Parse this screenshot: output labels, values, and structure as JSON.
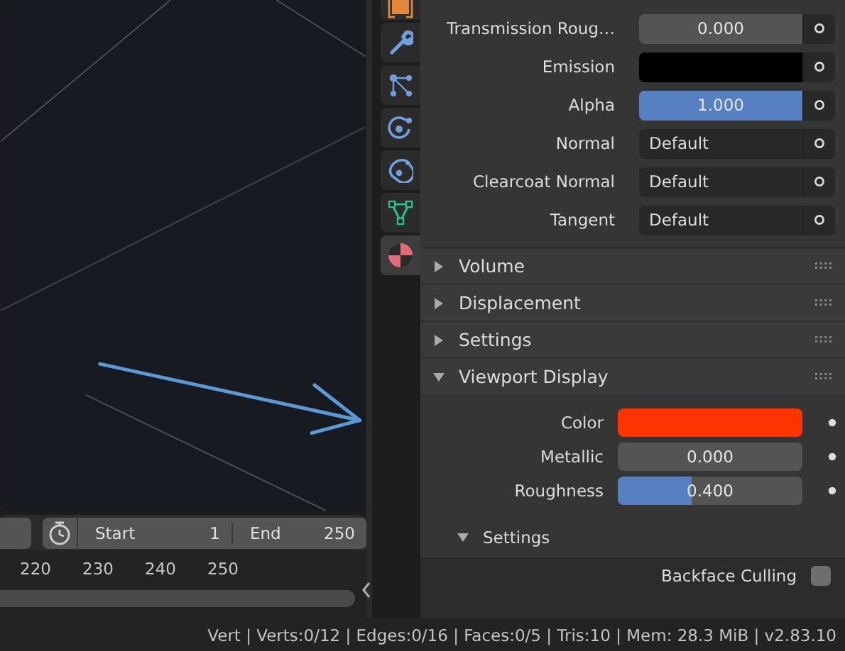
{
  "timeline": {
    "start_label": "Start",
    "start": "1",
    "end_label": "End",
    "end": "250",
    "ticks": [
      "220",
      "230",
      "240",
      "250"
    ]
  },
  "tabs": [
    {
      "kind": "object",
      "selected": false
    },
    {
      "kind": "modifier",
      "selected": false
    },
    {
      "kind": "particles",
      "selected": false
    },
    {
      "kind": "physics",
      "selected": false
    },
    {
      "kind": "constraints",
      "selected": false
    },
    {
      "kind": "data",
      "selected": false
    },
    {
      "kind": "material",
      "selected": true
    }
  ],
  "material_inputs": [
    {
      "label": "Transmission Roug…",
      "kind": "slider",
      "level": 0,
      "value": "0.000"
    },
    {
      "label": "Emission",
      "kind": "color",
      "color": "#000000"
    },
    {
      "label": "Alpha",
      "kind": "slider",
      "level": 1,
      "value": "1.000"
    },
    {
      "label": "Normal",
      "kind": "dropdown",
      "value": "Default"
    },
    {
      "label": "Clearcoat Normal",
      "kind": "dropdown",
      "value": "Default"
    },
    {
      "label": "Tangent",
      "kind": "dropdown",
      "value": "Default"
    }
  ],
  "panels": [
    {
      "title": "Volume",
      "expanded": false
    },
    {
      "title": "Displacement",
      "expanded": false
    },
    {
      "title": "Settings",
      "expanded": false
    },
    {
      "title": "Viewport Display",
      "expanded": true
    }
  ],
  "viewport_display": {
    "rows": [
      {
        "label": "Color",
        "kind": "color",
        "color": "#ff3300"
      },
      {
        "label": "Metallic",
        "kind": "slider",
        "level": 0,
        "value": "0.000"
      },
      {
        "label": "Roughness",
        "kind": "slider",
        "level": 0.4,
        "value": "0.400"
      }
    ],
    "subpanel": {
      "title": "Settings",
      "expanded": true
    },
    "backface_culling": {
      "label": "Backface Culling",
      "checked": false
    }
  },
  "status_bar": {
    "text": "Vert | Verts:0/12 | Edges:0/16 | Faces:0/5 | Tris:10 | Mem: 28.3 MiB | v2.83.10"
  }
}
